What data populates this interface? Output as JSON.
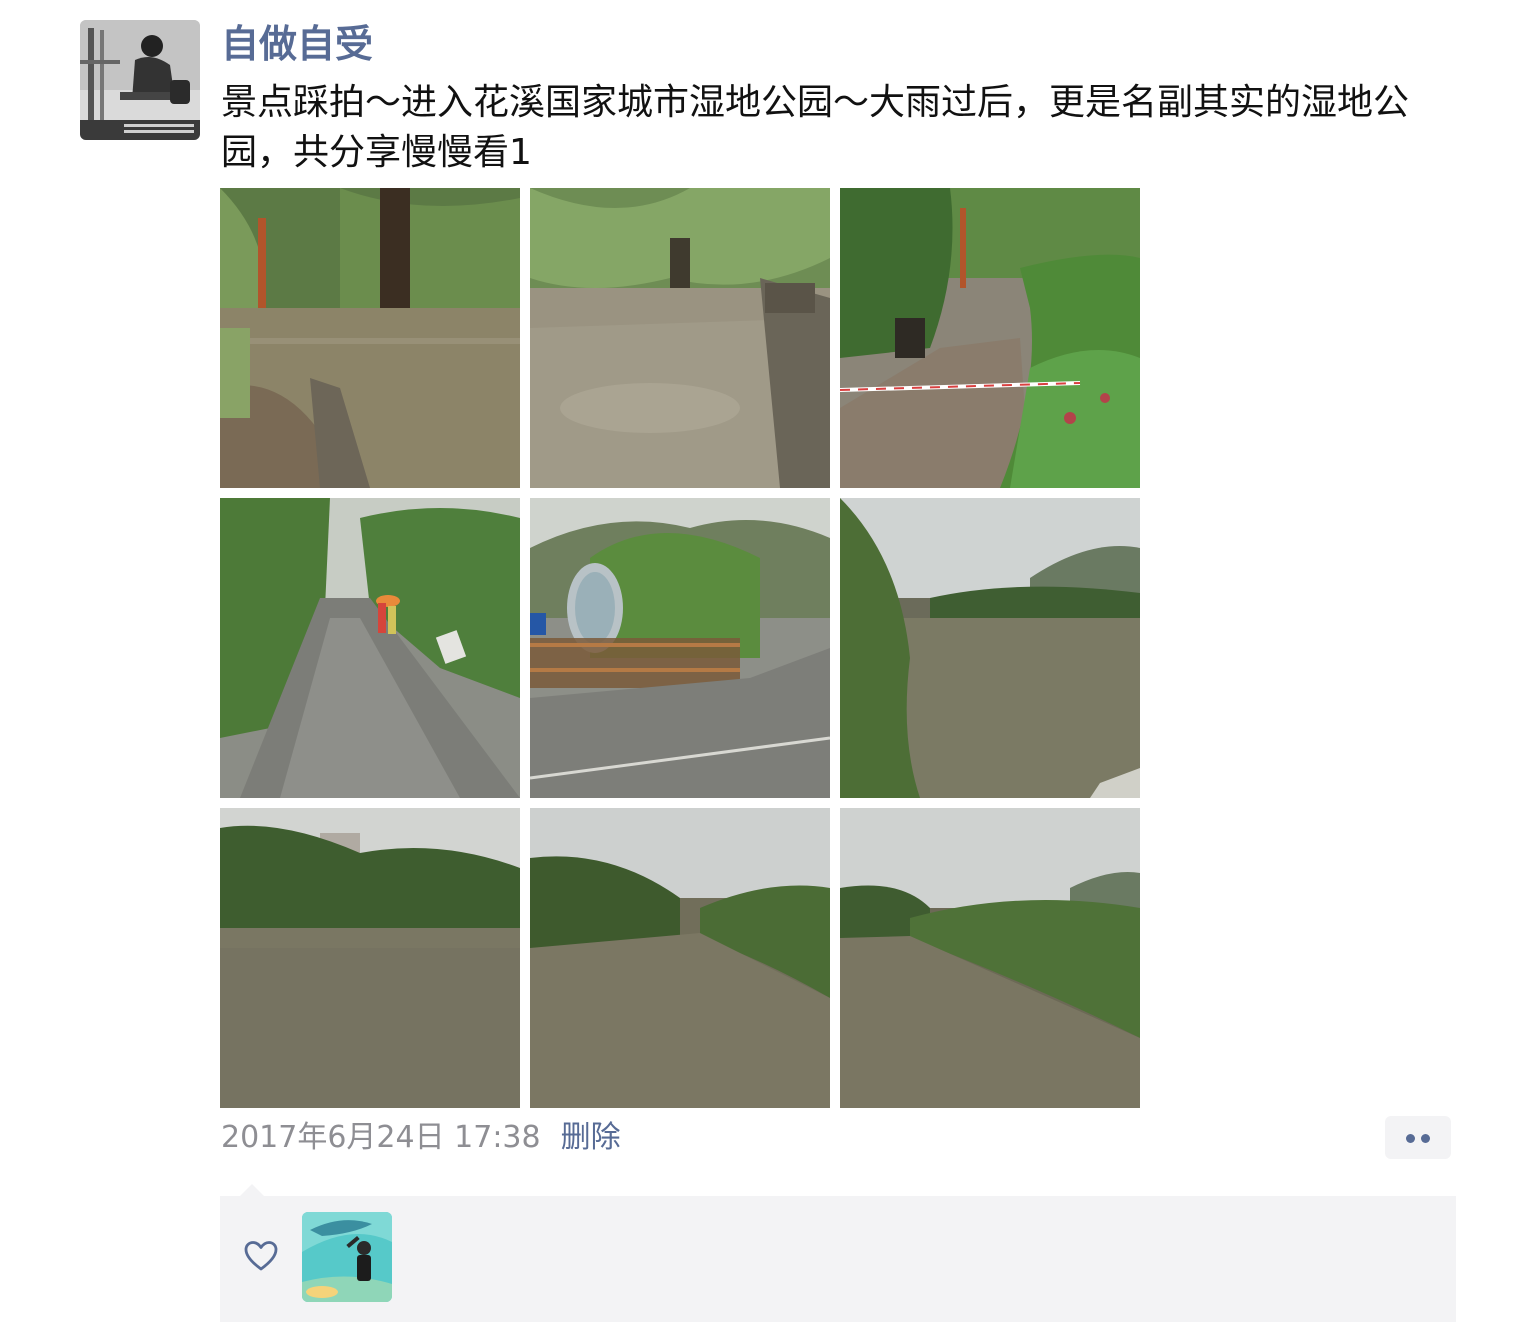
{
  "post": {
    "author_name": "自做自受",
    "text": "景点踩拍～进入花溪国家城市湿地公园～大雨过后，更是名副其实的湿地公园，共分享慢慢看1",
    "photos": [
      {
        "name": "photo-flooded-willow-path"
      },
      {
        "name": "photo-flooded-plaza"
      },
      {
        "name": "photo-taped-off-path"
      },
      {
        "name": "photo-wet-road-umbrella"
      },
      {
        "name": "photo-park-sign-fence"
      },
      {
        "name": "photo-river-willow"
      },
      {
        "name": "photo-river-bank-1"
      },
      {
        "name": "photo-river-bank-2"
      },
      {
        "name": "photo-river-bank-3"
      }
    ],
    "timestamp": "2017年6月24日 17:38",
    "delete_label": "删除",
    "more_icon": "more-dots-icon"
  },
  "likes": {
    "icon": "heart-outline-icon",
    "likers": [
      {
        "name": "liker-avatar"
      }
    ]
  },
  "colors": {
    "link": "#576b95",
    "meta_text": "#8e8e93",
    "panel_bg": "#f3f3f5"
  }
}
